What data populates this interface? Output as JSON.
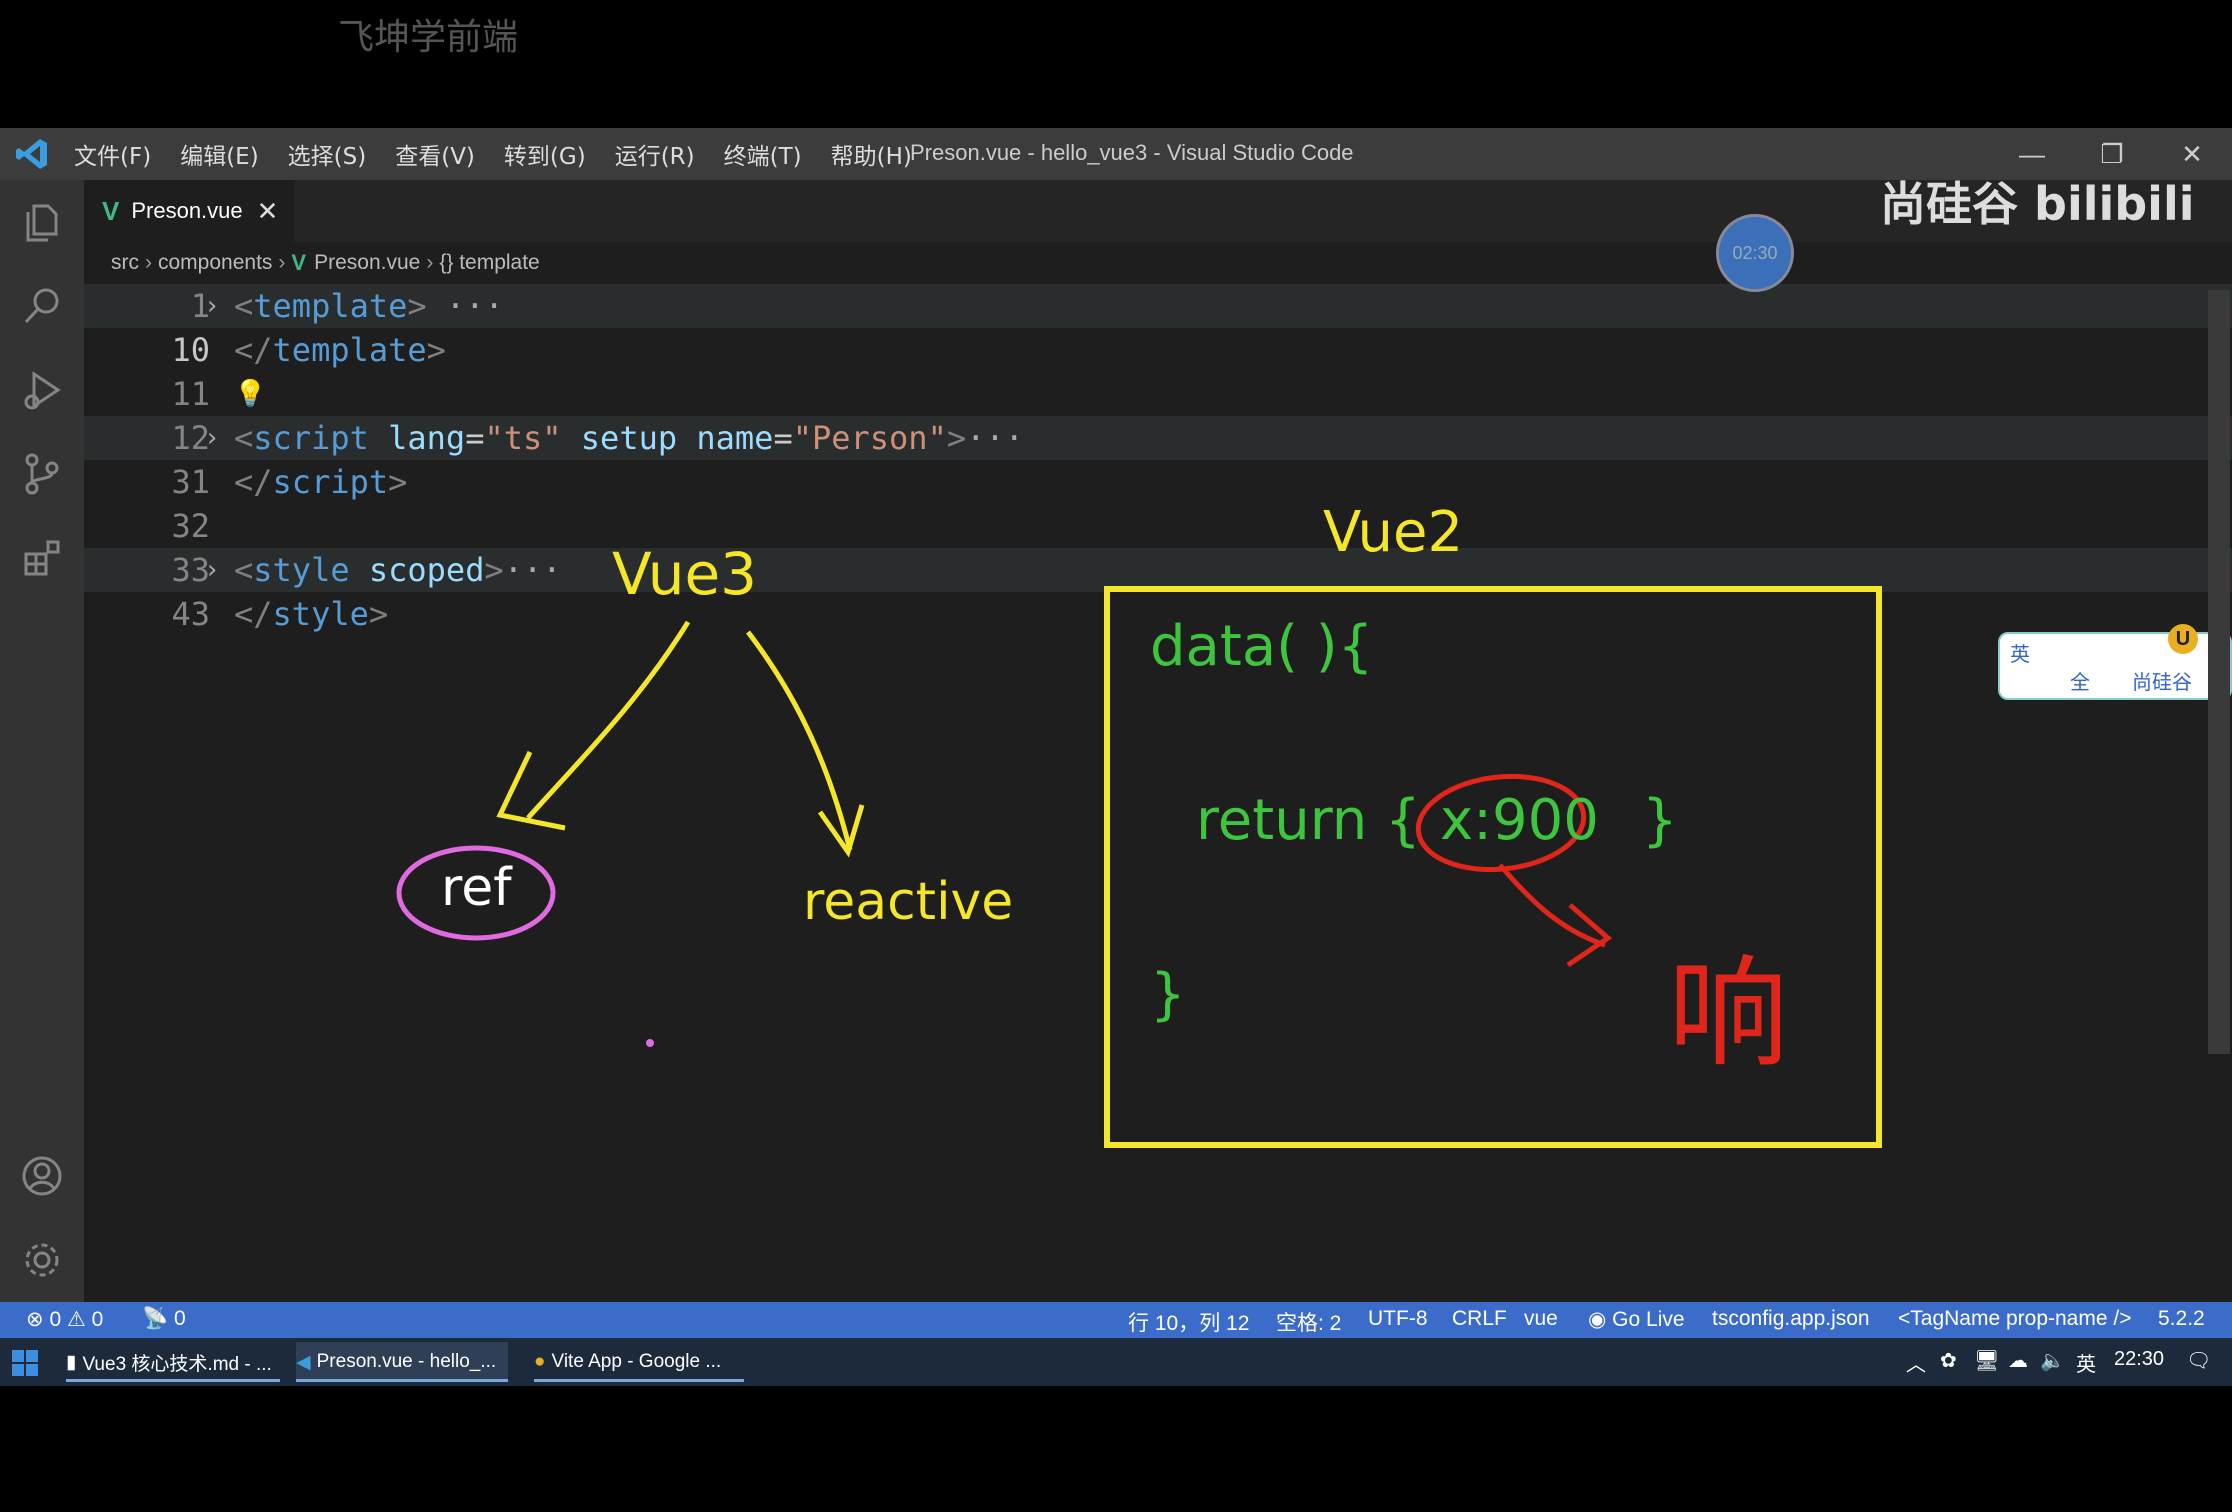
{
  "watermark": "飞坤学前端",
  "window": {
    "title": "Preson.vue - hello_vue3 - Visual Studio Code",
    "menu": [
      "文件(F)",
      "编辑(E)",
      "选择(S)",
      "查看(V)",
      "转到(G)",
      "运行(R)",
      "终端(T)",
      "帮助(H)"
    ]
  },
  "activity_bar": [
    "explorer-icon",
    "search-icon",
    "run-debug-icon",
    "source-control-icon",
    "extensions-icon",
    "account-icon",
    "settings-gear-icon"
  ],
  "tab": {
    "label": "Preson.vue",
    "close": "✕"
  },
  "breadcrumb": [
    "src",
    "components",
    "Preson.vue",
    "{} template"
  ],
  "code": {
    "ln1": "1",
    "ln10": "10",
    "ln11": "11",
    "ln12": "12",
    "ln31": "31",
    "ln32": "32",
    "ln33": "33",
    "ln43": "43",
    "l1_tag": "template",
    "l10_tag": "template",
    "l12_tag": "script",
    "l12_attr1": "lang",
    "l12_val1": "\"ts\"",
    "l12_attr2": "setup",
    "l12_attr3": "name",
    "l12_val3": "\"Person\"",
    "l31_tag": "script",
    "l33_tag": "style",
    "l33_attr": "scoped",
    "l43_tag": "style",
    "ellipsis": "···"
  },
  "annotations": {
    "vue3": "Vue3",
    "ref": "ref",
    "reactive": "reactive",
    "vue2": "Vue2",
    "data": "data( ){",
    "return_open": "return {",
    "x900": "x:900",
    "return_close": "}",
    "close_brace": "}",
    "handwritten": "响"
  },
  "overlay": {
    "timer": "02:30",
    "brand": "尚硅谷 bilibili",
    "ime": [
      "英",
      "全",
      "尚硅谷"
    ]
  },
  "status_bar": {
    "errors": "0",
    "warnings": "0",
    "ports": "0",
    "position": "行 10，列 12",
    "spaces": "空格: 2",
    "encoding": "UTF-8",
    "eol": "CRLF",
    "language": "vue",
    "go_live": "Go Live",
    "tsconfig": "tsconfig.app.json",
    "tagname": "<TagName prop-name />",
    "version": "5.2.2"
  },
  "taskbar": {
    "apps": [
      "Vue3 核心技术.md - ...",
      "Preson.vue - hello_...",
      "Vite App - Google ..."
    ],
    "tray_lang": "英",
    "clock": "22:30"
  },
  "colors": {
    "annotation_yellow": "#f5e62a",
    "annotation_green": "#3ec43e",
    "annotation_red": "#e0261a",
    "annotation_pink": "#e06ae0",
    "statusbar_blue": "#3b6cc9"
  }
}
